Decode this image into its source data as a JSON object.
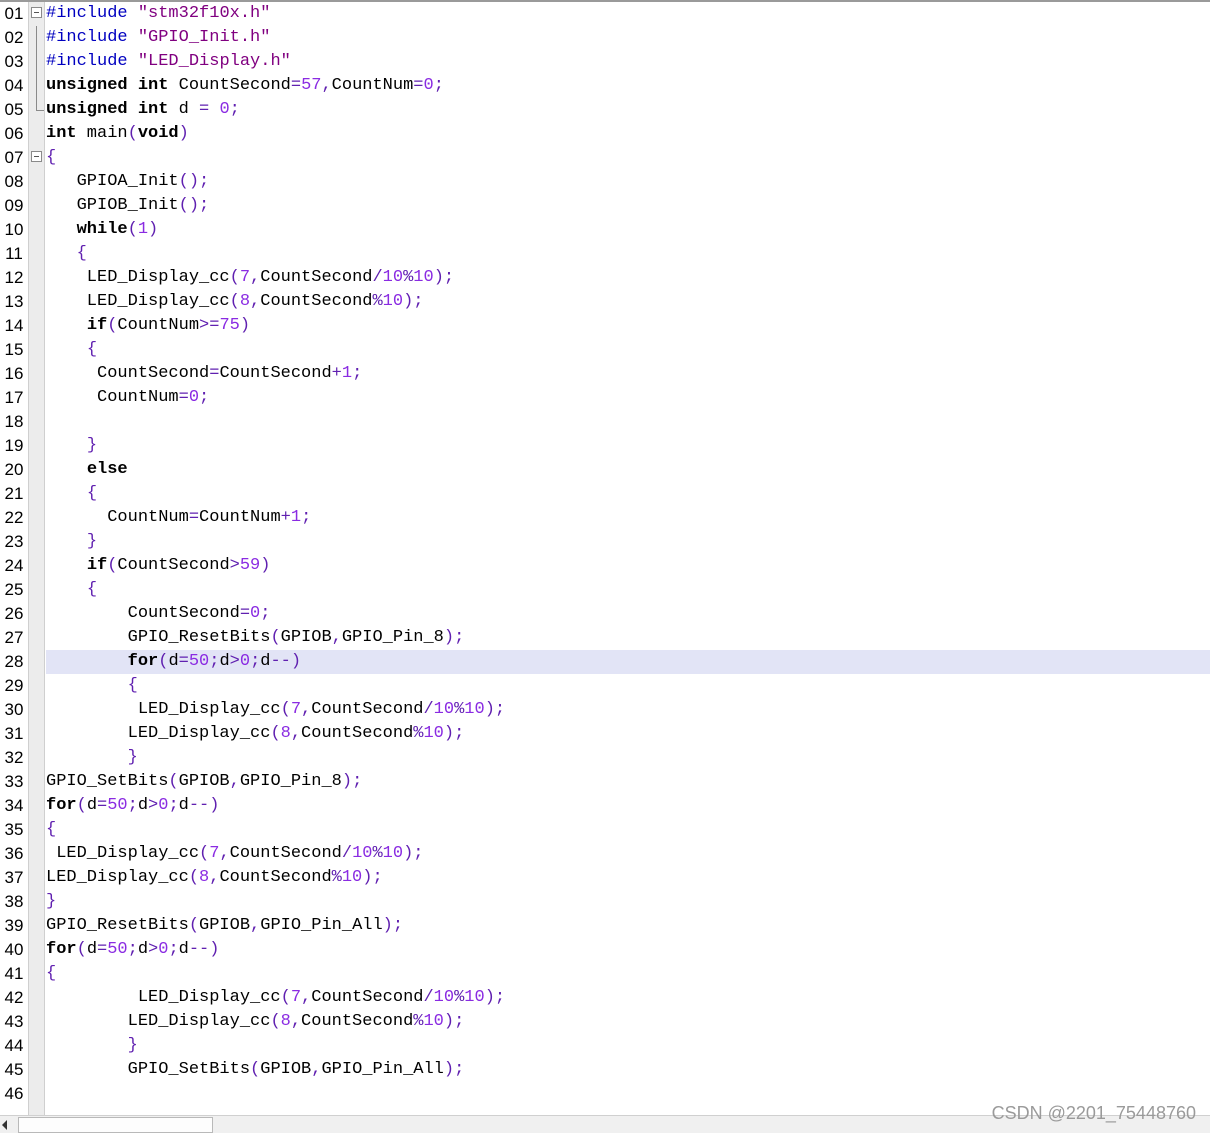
{
  "editor": {
    "highlighted_line": "28",
    "lines": [
      {
        "n": "01",
        "text": "#include \"stm32f10x.h\""
      },
      {
        "n": "02",
        "text": "#include \"GPIO_Init.h\""
      },
      {
        "n": "03",
        "text": "#include \"LED_Display.h\""
      },
      {
        "n": "04",
        "text": "unsigned int CountSecond=57,CountNum=0;"
      },
      {
        "n": "05",
        "text": "unsigned int d = 0;"
      },
      {
        "n": "06",
        "text": "int main(void)"
      },
      {
        "n": "07",
        "text": "{"
      },
      {
        "n": "08",
        "text": "   GPIOA_Init();"
      },
      {
        "n": "09",
        "text": "   GPIOB_Init();"
      },
      {
        "n": "10",
        "text": "   while(1)"
      },
      {
        "n": "11",
        "text": "   {"
      },
      {
        "n": "12",
        "text": "    LED_Display_cc(7,CountSecond/10%10);"
      },
      {
        "n": "13",
        "text": "    LED_Display_cc(8,CountSecond%10);"
      },
      {
        "n": "14",
        "text": "    if(CountNum>=75)"
      },
      {
        "n": "15",
        "text": "    {"
      },
      {
        "n": "16",
        "text": "     CountSecond=CountSecond+1;"
      },
      {
        "n": "17",
        "text": "     CountNum=0;"
      },
      {
        "n": "18",
        "text": ""
      },
      {
        "n": "19",
        "text": "    }"
      },
      {
        "n": "20",
        "text": "    else"
      },
      {
        "n": "21",
        "text": "    {"
      },
      {
        "n": "22",
        "text": "      CountNum=CountNum+1;"
      },
      {
        "n": "23",
        "text": "    }"
      },
      {
        "n": "24",
        "text": "    if(CountSecond>59)"
      },
      {
        "n": "25",
        "text": "    {"
      },
      {
        "n": "26",
        "text": "        CountSecond=0;"
      },
      {
        "n": "27",
        "text": "        GPIO_ResetBits(GPIOB,GPIO_Pin_8);"
      },
      {
        "n": "28",
        "text": "        for(d=50;d>0;d--)"
      },
      {
        "n": "29",
        "text": "        {"
      },
      {
        "n": "30",
        "text": "         LED_Display_cc(7,CountSecond/10%10);"
      },
      {
        "n": "31",
        "text": "        LED_Display_cc(8,CountSecond%10);"
      },
      {
        "n": "32",
        "text": "        }"
      },
      {
        "n": "33",
        "text": "GPIO_SetBits(GPIOB,GPIO_Pin_8);"
      },
      {
        "n": "34",
        "text": "for(d=50;d>0;d--)"
      },
      {
        "n": "35",
        "text": "{"
      },
      {
        "n": "36",
        "text": " LED_Display_cc(7,CountSecond/10%10);"
      },
      {
        "n": "37",
        "text": "LED_Display_cc(8,CountSecond%10);"
      },
      {
        "n": "38",
        "text": "}"
      },
      {
        "n": "39",
        "text": "GPIO_ResetBits(GPIOB,GPIO_Pin_All);"
      },
      {
        "n": "40",
        "text": "for(d=50;d>0;d--)"
      },
      {
        "n": "41",
        "text": "{"
      },
      {
        "n": "42",
        "text": "         LED_Display_cc(7,CountSecond/10%10);"
      },
      {
        "n": "43",
        "text": "        LED_Display_cc(8,CountSecond%10);"
      },
      {
        "n": "44",
        "text": "        }"
      },
      {
        "n": "45",
        "text": "        GPIO_SetBits(GPIOB,GPIO_Pin_All);"
      },
      {
        "n": "46",
        "text": ""
      }
    ]
  },
  "watermark": "CSDN @2201_75448760",
  "icons": {
    "fold": "minus-box-icon",
    "scroll_left": "arrow-left-icon"
  }
}
